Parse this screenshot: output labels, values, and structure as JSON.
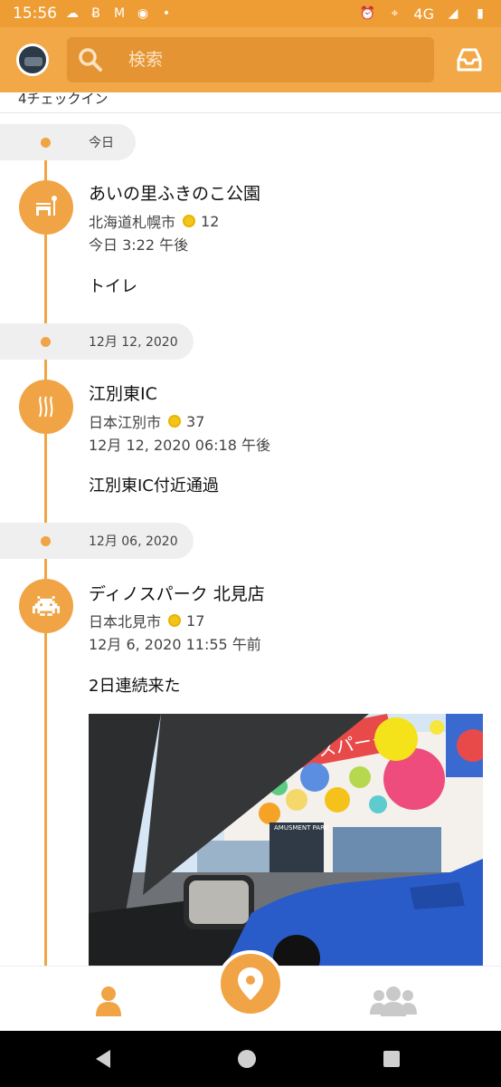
{
  "status_bar": {
    "time": "15:56",
    "network": "4G",
    "icons": [
      "cloud-icon",
      "b-icon",
      "gmail-icon",
      "line-icon",
      "dot-icon",
      "alarm-icon",
      "location-icon",
      "signal-icon",
      "battery-icon"
    ]
  },
  "header": {
    "search_placeholder": "検索",
    "checkin_count_label": "4チェックイン"
  },
  "timeline": [
    {
      "date": "今日",
      "venue_name": "あいの里ふきのこ公園",
      "location": "北海道札幌市",
      "coins": "12",
      "time": "今日 3:22 午後",
      "note": "トイレ",
      "icon": "bench-icon"
    },
    {
      "date": "12月 12, 2020",
      "venue_name": "江別東IC",
      "location": "日本江別市",
      "coins": "37",
      "time": "12月 12, 2020 06:18 午後",
      "note": "江別東IC付近通過",
      "icon": "road-icon"
    },
    {
      "date": "12月 06, 2020",
      "venue_name": "ディノスパーク 北見店",
      "location": "日本北見市",
      "coins": "17",
      "time": "12月 6, 2020 11:55 午前",
      "note": "2日連続来た",
      "icon": "space-invader-icon"
    }
  ],
  "photo": {
    "sign_text": "AMUSMENT PARK",
    "banner_text": "ディノスパーク"
  },
  "colors": {
    "accent": "#f0a445",
    "status_bar": "#ee9d34",
    "search_bg": "#e49432"
  }
}
